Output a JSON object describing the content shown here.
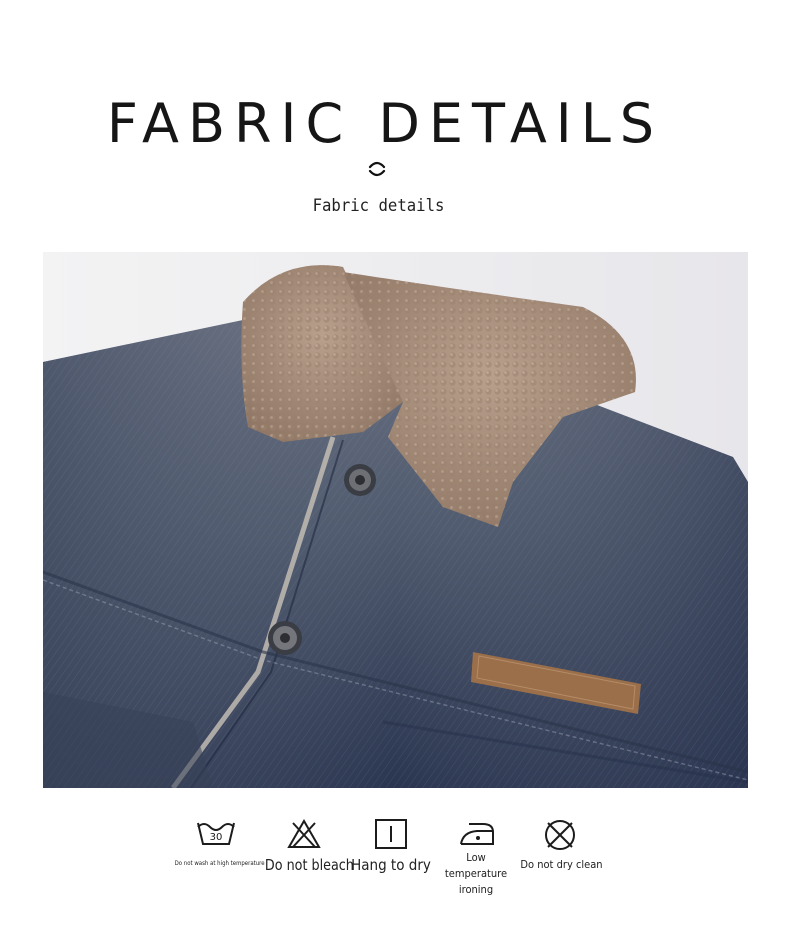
{
  "header": {
    "title": "FABRIC DETAILS",
    "subtitle": "Fabric details"
  },
  "product_image": {
    "subject": "denim jacket with sherpa collar",
    "colors": {
      "denim_light": "#5b6473",
      "denim_dark": "#27324a",
      "sherpa": "#a88f7c",
      "patch": "#9a6f4a",
      "background": "#f1f1f3"
    }
  },
  "care_instructions": [
    {
      "icon": "wash-30-icon",
      "label": "Do not wash at high temperature",
      "value": "30"
    },
    {
      "icon": "no-bleach-icon",
      "label": "Do not bleach"
    },
    {
      "icon": "hang-dry-icon",
      "label": "Hang to dry"
    },
    {
      "icon": "low-iron-icon",
      "label": "Low temperature ironing"
    },
    {
      "icon": "no-dry-clean-icon",
      "label": "Do not dry clean"
    }
  ]
}
